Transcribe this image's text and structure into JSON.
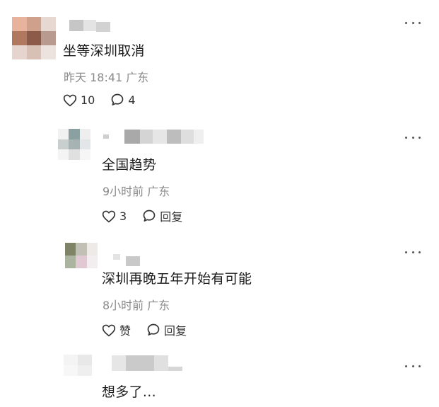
{
  "comments": [
    {
      "text": "坐等深圳取消",
      "meta": "昨天 18:41 广东",
      "likes": "10",
      "replies": "4"
    },
    {
      "text": "全国趋势",
      "meta": "9小时前 广东",
      "likes": "3",
      "reply_label": "回复"
    },
    {
      "text": "深圳再晚五年开始有可能",
      "meta": "8小时前 广东",
      "like_label": "赞",
      "reply_label": "回复"
    },
    {
      "text": "想多了..."
    }
  ],
  "icons": {
    "like": "heart-outline-icon",
    "reply": "comment-bubble-icon",
    "more": "more-horizontal-icon"
  },
  "colors": {
    "text": "#1c1c1c",
    "meta": "#8a8a8a",
    "icon": "#333333"
  }
}
